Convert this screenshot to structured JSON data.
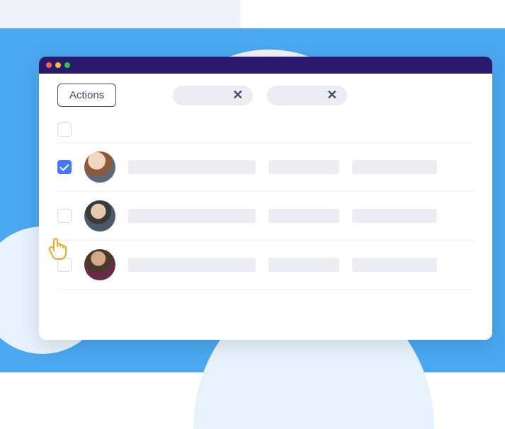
{
  "toolbar": {
    "actions_label": "Actions"
  },
  "filters": [
    {
      "close": "✕"
    },
    {
      "close": "✕"
    }
  ],
  "rows": [
    {
      "checked": true
    },
    {
      "checked": false
    },
    {
      "checked": false
    }
  ]
}
